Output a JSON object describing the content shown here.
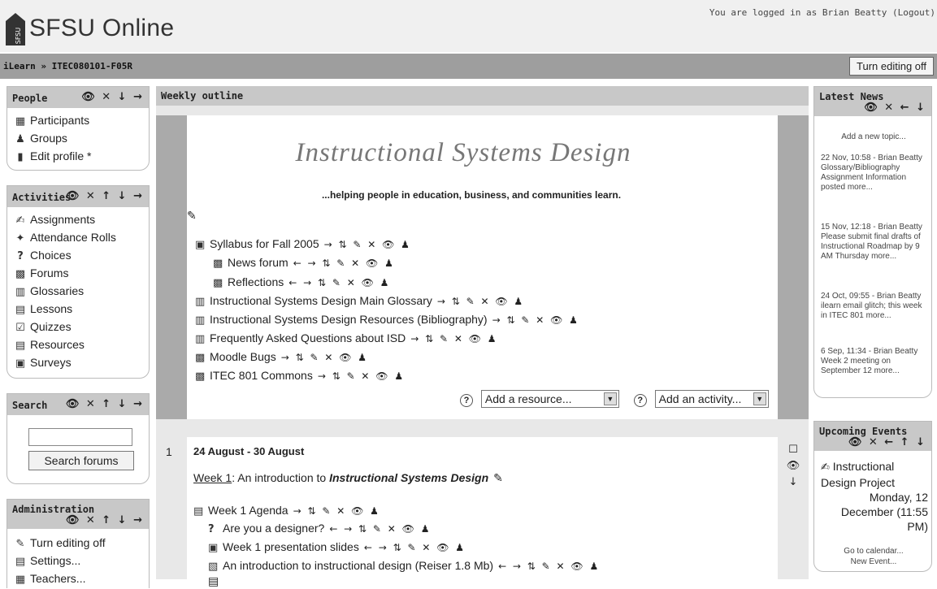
{
  "header": {
    "site_name": "SFSU Online",
    "logo_letters": "SFSU",
    "login_text": "You are logged in as Brian Beatty",
    "logout_label": "(Logout)"
  },
  "navbar": {
    "home": "iLearn",
    "separator": "»",
    "course": "ITEC080101-F05R",
    "edit_button": "Turn editing off"
  },
  "people": {
    "title": "People",
    "controls": "👁 ✕ ↓ →",
    "items": [
      "Participants",
      "Groups",
      "Edit profile *"
    ]
  },
  "activities": {
    "title": "Activities",
    "controls": "👁 ✕ ↑ ↓ →",
    "items": [
      "Assignments",
      "Attendance Rolls",
      "Choices",
      "Forums",
      "Glossaries",
      "Lessons",
      "Quizzes",
      "Resources",
      "Surveys"
    ]
  },
  "search": {
    "title": "Search",
    "controls": "👁 ✕ ↑ ↓ →",
    "input_value": "",
    "button": "Search forums"
  },
  "admin": {
    "title": "Administration",
    "controls": "👁 ✕ ↑ ↓ →",
    "items": [
      "Turn editing off",
      "Settings...",
      "Teachers..."
    ]
  },
  "main": {
    "heading": "Weekly outline",
    "banner_title": "Instructional Systems Design",
    "banner_tagline": "...helping people in education, business, and communities learn.",
    "section0_items": [
      "Syllabus for Fall 2005",
      "News forum",
      "Reflections",
      "Instructional Systems Design Main Glossary",
      "Instructional Systems Design Resources (Bibliography)",
      "Frequently Asked Questions about ISD",
      "Moodle Bugs",
      "ITEC 801 Commons"
    ],
    "controls_a": "→ ⇅ ✎ ✕ 👁 ♟",
    "controls_b": "← → ⇅ ✎ ✕ 👁 ♟",
    "add_resource": "Add a resource...",
    "add_activity": "Add an activity...",
    "week_number": "1",
    "week_dates": "24 August - 30 August",
    "week_link": "Week 1",
    "week_summary_prefix": ": An introduction to ",
    "week_summary_em": "Instructional Systems Design",
    "week_items": [
      "Week 1 Agenda",
      "Are you a designer?",
      "Week 1 presentation slides",
      "An introduction to instructional design (Reiser 1.8 Mb)"
    ]
  },
  "news": {
    "title": "Latest News",
    "controls": "👁 ✕ ← ↓",
    "add_topic": "Add a new topic...",
    "items": [
      {
        "date": "22 Nov, 10:58 - Brian Beatty",
        "text": "Glossary/Bibliography Assignment Information posted",
        "more": "more..."
      },
      {
        "date": "15 Nov, 12:18 - Brian Beatty",
        "text": "Please submit final drafts of Instructional Roadmap by 9 AM Thursday",
        "more": "more..."
      },
      {
        "date": "24 Oct, 09:55 - Brian Beatty",
        "text": "ilearn email glitch; this week in ITEC 801",
        "more": "more..."
      },
      {
        "date": "6 Sep, 11:34 - Brian Beatty",
        "text": "Week 2 meeting on September 12",
        "more": "more..."
      }
    ]
  },
  "events": {
    "title": "Upcoming Events",
    "controls": "👁 ✕ ← ↑ ↓",
    "event_name": "Instructional Design Project",
    "event_date": "Monday, 12 December (11:55 PM)",
    "go_calendar": "Go to calendar...",
    "new_event": "New Event..."
  }
}
